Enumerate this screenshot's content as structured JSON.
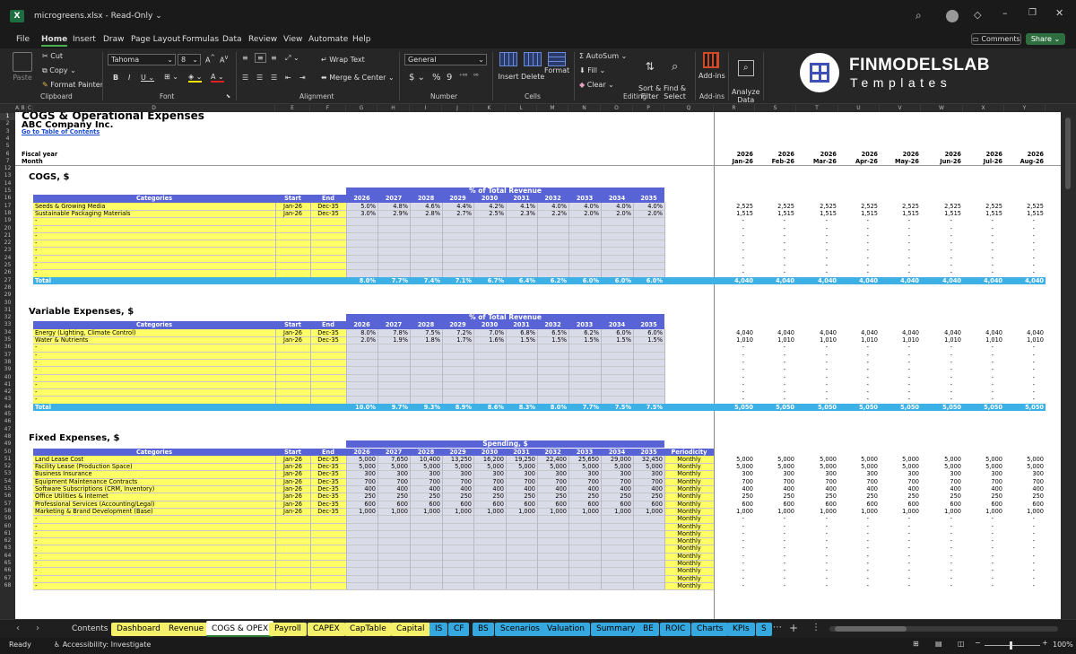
{
  "titlebar": {
    "filename": "microgreens.xlsx",
    "readonly": "Read-Only"
  },
  "menu": [
    "File",
    "Home",
    "Insert",
    "Draw",
    "Page Layout",
    "Formulas",
    "Data",
    "Review",
    "View",
    "Automate",
    "Help"
  ],
  "comments_label": "Comments",
  "share_label": "Share",
  "ribbon": {
    "clipboard": {
      "paste": "Paste",
      "cut": "Cut",
      "copy": "Copy",
      "format_painter": "Format Painter",
      "group": "Clipboard"
    },
    "font": {
      "name": "Tahoma",
      "size": "8",
      "group": "Font"
    },
    "alignment": {
      "wrap": "Wrap Text",
      "merge": "Merge & Center",
      "group": "Alignment"
    },
    "number": {
      "format": "General",
      "group": "Number"
    },
    "cells": {
      "insert": "Insert",
      "delete": "Delete",
      "format": "Format",
      "group": "Cells"
    },
    "editing": {
      "autosum": "AutoSum",
      "fill": "Fill",
      "clear": "Clear",
      "sort": "Sort &\nFilter",
      "find": "Find &\nSelect",
      "group": "Editing"
    },
    "addins": {
      "label": "Add-ins",
      "group": "Add-ins"
    },
    "analyze": {
      "label": "Analyze\nData"
    },
    "brand": {
      "name": "FINMODELSLAB",
      "sub": "Templates"
    }
  },
  "columns": [
    "A",
    "B",
    "C",
    "D",
    "E",
    "F",
    "G",
    "H",
    "I",
    "J",
    "K",
    "L",
    "M",
    "N",
    "O",
    "P",
    "Q",
    "R",
    "S",
    "T",
    "U",
    "V",
    "W",
    "X",
    "Y"
  ],
  "sheet": {
    "title": "COGS & Operational Expenses",
    "company": "ABC Company Inc.",
    "link": "Go to Table of Contents",
    "fiscal_year_label": "Fiscal year",
    "month_label": "Month",
    "month_years": [
      "2026",
      "2026",
      "2026",
      "2026",
      "2026",
      "2026",
      "2026",
      "2026"
    ],
    "months": [
      "Jan-26",
      "Feb-26",
      "Mar-26",
      "Apr-26",
      "May-26",
      "Jun-26",
      "Jul-26",
      "Aug-26"
    ],
    "years": [
      "2026",
      "2027",
      "2028",
      "2029",
      "2030",
      "2031",
      "2032",
      "2033",
      "2034",
      "2035"
    ],
    "col_headers": {
      "categories": "Categories",
      "start": "Start",
      "end": "End",
      "periodicity": "Periodicity"
    },
    "cogs": {
      "title": "COGS, $",
      "band": "% of Total Revenue",
      "total_label": "Total",
      "rows": [
        {
          "name": "Seeds & Growing Media",
          "start": "Jan-26",
          "end": "Dec-35",
          "pct": [
            "5.0%",
            "4.8%",
            "4.6%",
            "4.4%",
            "4.2%",
            "4.1%",
            "4.0%",
            "4.0%",
            "4.0%",
            "4.0%"
          ],
          "monthly": [
            "2,525",
            "2,525",
            "2,525",
            "2,525",
            "2,525",
            "2,525",
            "2,525",
            "2,525"
          ]
        },
        {
          "name": "Sustainable Packaging Materials",
          "start": "Jan-26",
          "end": "Dec-35",
          "pct": [
            "3.0%",
            "2.9%",
            "2.8%",
            "2.7%",
            "2.5%",
            "2.3%",
            "2.2%",
            "2.0%",
            "2.0%",
            "2.0%"
          ],
          "monthly": [
            "1,515",
            "1,515",
            "1,515",
            "1,515",
            "1,515",
            "1,515",
            "1,515",
            "1,515"
          ]
        }
      ],
      "total_pct": [
        "8.0%",
        "7.7%",
        "7.4%",
        "7.1%",
        "6.7%",
        "6.4%",
        "6.2%",
        "6.0%",
        "6.0%",
        "6.0%"
      ],
      "total_monthly": [
        "4,040",
        "4,040",
        "4,040",
        "4,040",
        "4,040",
        "4,040",
        "4,040",
        "4,040"
      ]
    },
    "variable": {
      "title": "Variable Expenses, $",
      "band": "% of Total Revenue",
      "total_label": "Total",
      "rows": [
        {
          "name": "Energy (Lighting, Climate Control)",
          "start": "Jan-26",
          "end": "Dec-35",
          "pct": [
            "8.0%",
            "7.8%",
            "7.5%",
            "7.2%",
            "7.0%",
            "6.8%",
            "6.5%",
            "6.2%",
            "6.0%",
            "6.0%"
          ],
          "monthly": [
            "4,040",
            "4,040",
            "4,040",
            "4,040",
            "4,040",
            "4,040",
            "4,040",
            "4,040"
          ]
        },
        {
          "name": "Water & Nutrients",
          "start": "Jan-26",
          "end": "Dec-35",
          "pct": [
            "2.0%",
            "1.9%",
            "1.8%",
            "1.7%",
            "1.6%",
            "1.5%",
            "1.5%",
            "1.5%",
            "1.5%",
            "1.5%"
          ],
          "monthly": [
            "1,010",
            "1,010",
            "1,010",
            "1,010",
            "1,010",
            "1,010",
            "1,010",
            "1,010"
          ]
        }
      ],
      "total_pct": [
        "10.0%",
        "9.7%",
        "9.3%",
        "8.9%",
        "8.6%",
        "8.3%",
        "8.0%",
        "7.7%",
        "7.5%",
        "7.5%"
      ],
      "total_monthly": [
        "5,050",
        "5,050",
        "5,050",
        "5,050",
        "5,050",
        "5,050",
        "5,050",
        "5,050"
      ]
    },
    "fixed": {
      "title": "Fixed Expenses, $",
      "band": "Spending, $",
      "periodicity": "Monthly",
      "rows": [
        {
          "name": "Land Lease Cost",
          "start": "Jan-26",
          "end": "Dec-35",
          "vals": [
            "5,000",
            "7,650",
            "10,400",
            "13,250",
            "16,200",
            "19,250",
            "22,400",
            "25,650",
            "29,000",
            "32,450"
          ],
          "monthly": [
            "5,000",
            "5,000",
            "5,000",
            "5,000",
            "5,000",
            "5,000",
            "5,000",
            "5,000"
          ]
        },
        {
          "name": "Facility Lease (Production Space)",
          "start": "Jan-26",
          "end": "Dec-35",
          "vals": [
            "5,000",
            "5,000",
            "5,000",
            "5,000",
            "5,000",
            "5,000",
            "5,000",
            "5,000",
            "5,000",
            "5,000"
          ],
          "monthly": [
            "5,000",
            "5,000",
            "5,000",
            "5,000",
            "5,000",
            "5,000",
            "5,000",
            "5,000"
          ]
        },
        {
          "name": "Business Insurance",
          "start": "Jan-26",
          "end": "Dec-35",
          "vals": [
            "300",
            "300",
            "300",
            "300",
            "300",
            "300",
            "300",
            "300",
            "300",
            "300"
          ],
          "monthly": [
            "300",
            "300",
            "300",
            "300",
            "300",
            "300",
            "300",
            "300"
          ]
        },
        {
          "name": "Equipment Maintenance Contracts",
          "start": "Jan-26",
          "end": "Dec-35",
          "vals": [
            "700",
            "700",
            "700",
            "700",
            "700",
            "700",
            "700",
            "700",
            "700",
            "700"
          ],
          "monthly": [
            "700",
            "700",
            "700",
            "700",
            "700",
            "700",
            "700",
            "700"
          ]
        },
        {
          "name": "Software Subscriptions (CRM, Inventory)",
          "start": "Jan-26",
          "end": "Dec-35",
          "vals": [
            "400",
            "400",
            "400",
            "400",
            "400",
            "400",
            "400",
            "400",
            "400",
            "400"
          ],
          "monthly": [
            "400",
            "400",
            "400",
            "400",
            "400",
            "400",
            "400",
            "400"
          ]
        },
        {
          "name": "Office Utilities & Internet",
          "start": "Jan-26",
          "end": "Dec-35",
          "vals": [
            "250",
            "250",
            "250",
            "250",
            "250",
            "250",
            "250",
            "250",
            "250",
            "250"
          ],
          "monthly": [
            "250",
            "250",
            "250",
            "250",
            "250",
            "250",
            "250",
            "250"
          ]
        },
        {
          "name": "Professional Services (Accounting/Legal)",
          "start": "Jan-26",
          "end": "Dec-35",
          "vals": [
            "600",
            "600",
            "600",
            "600",
            "600",
            "600",
            "600",
            "600",
            "600",
            "600"
          ],
          "monthly": [
            "600",
            "600",
            "600",
            "600",
            "600",
            "600",
            "600",
            "600"
          ]
        },
        {
          "name": "Marketing & Brand Development (Base)",
          "start": "Jan-26",
          "end": "Dec-35",
          "vals": [
            "1,000",
            "1,000",
            "1,000",
            "1,000",
            "1,000",
            "1,000",
            "1,000",
            "1,000",
            "1,000",
            "1,000"
          ],
          "monthly": [
            "1,000",
            "1,000",
            "1,000",
            "1,000",
            "1,000",
            "1,000",
            "1,000",
            "1,000"
          ]
        }
      ]
    }
  },
  "tabs": [
    {
      "label": "Contents",
      "color": "none"
    },
    {
      "label": "Dashboard",
      "color": "#f5f06a"
    },
    {
      "label": "Revenue",
      "color": "#f5f06a"
    },
    {
      "label": "COGS & OPEX",
      "color": "active"
    },
    {
      "label": "Payroll",
      "color": "#f5f06a"
    },
    {
      "label": "CAPEX",
      "color": "#f5f06a"
    },
    {
      "label": "CapTable",
      "color": "#f5f06a"
    },
    {
      "label": "Capital",
      "color": "#f5f06a"
    },
    {
      "label": "IS",
      "color": "#35a8e0"
    },
    {
      "label": "CF",
      "color": "#35a8e0"
    },
    {
      "label": "BS",
      "color": "#35a8e0"
    },
    {
      "label": "Scenarios",
      "color": "#35a8e0"
    },
    {
      "label": "Valuation",
      "color": "#35a8e0"
    },
    {
      "label": "Summary",
      "color": "#35a8e0"
    },
    {
      "label": "BE",
      "color": "#35a8e0"
    },
    {
      "label": "ROIC",
      "color": "#35a8e0"
    },
    {
      "label": "Charts",
      "color": "#35a8e0"
    },
    {
      "label": "KPIs",
      "color": "#35a8e0"
    },
    {
      "label": "S",
      "color": "#35a8e0"
    }
  ],
  "status": {
    "ready": "Ready",
    "accessibility": "Accessibility: Investigate",
    "zoom": "100%"
  }
}
